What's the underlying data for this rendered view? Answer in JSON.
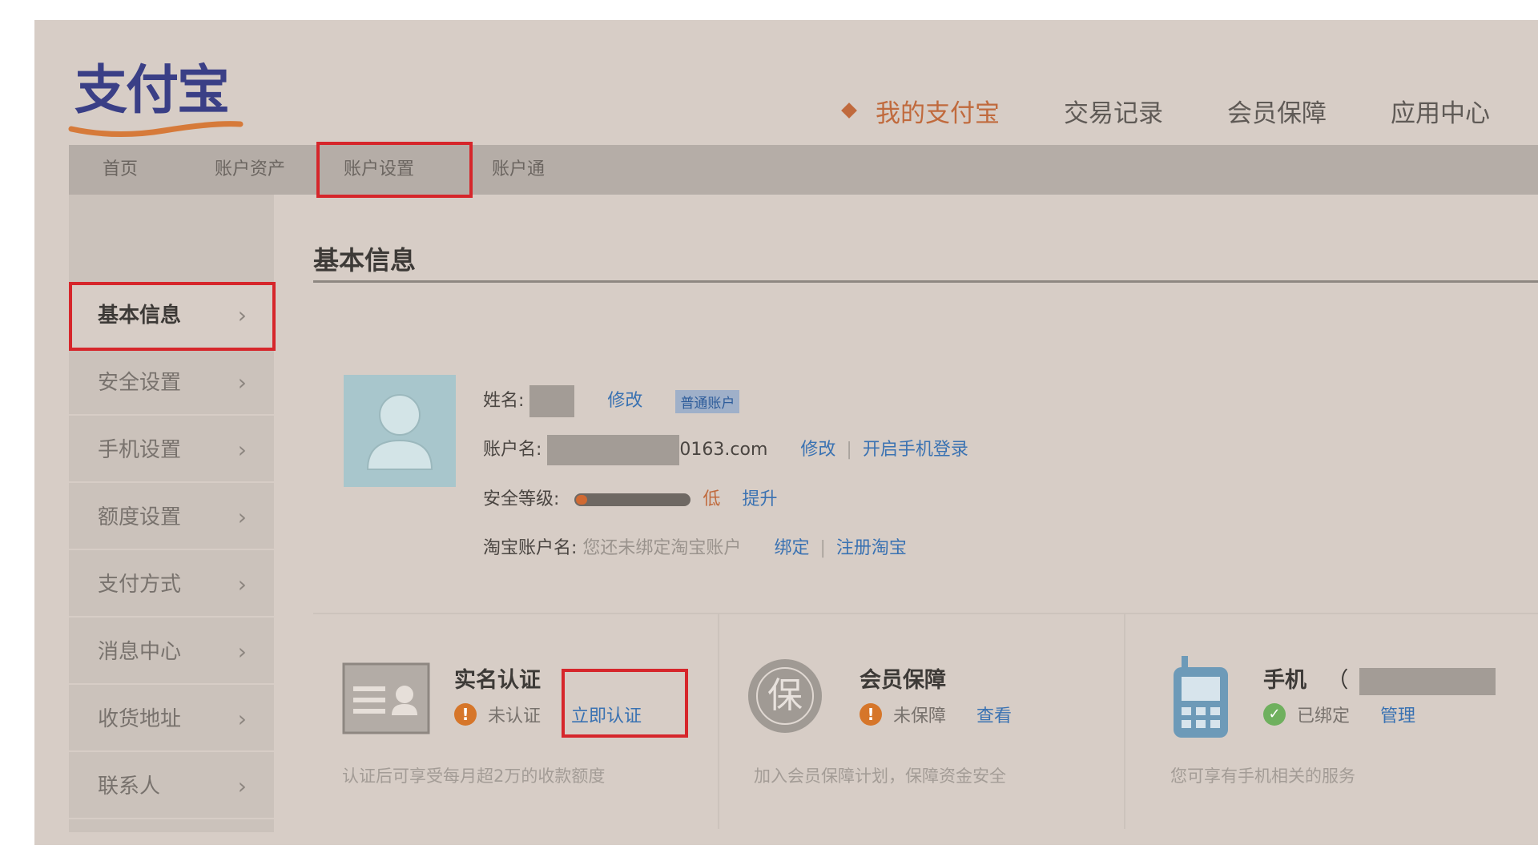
{
  "brand": {
    "logo_text": "支付宝"
  },
  "topnav": [
    {
      "label": "我的支付宝",
      "active": true
    },
    {
      "label": "交易记录"
    },
    {
      "label": "会员保障"
    },
    {
      "label": "应用中心"
    }
  ],
  "subnav": [
    {
      "label": "首页"
    },
    {
      "label": "账户资产"
    },
    {
      "label": "账户设置",
      "active": true
    },
    {
      "label": "账户通"
    }
  ],
  "sidebar": [
    {
      "label": "基本信息",
      "active": true
    },
    {
      "label": "安全设置"
    },
    {
      "label": "手机设置"
    },
    {
      "label": "额度设置"
    },
    {
      "label": "支付方式"
    },
    {
      "label": "消息中心"
    },
    {
      "label": "收货地址"
    },
    {
      "label": "联系人"
    }
  ],
  "sidebar_chevron": "›",
  "main": {
    "title": "基本信息",
    "profile": {
      "name_label": "姓名:",
      "name_edit": "修改",
      "account_type": "普通账户",
      "account_label": "账户名:",
      "account_suffix": "0163.com",
      "account_edit": "修改",
      "phone_login": "开启手机登录",
      "security_label": "安全等级:",
      "security_level_text": "低",
      "security_level_fraction": 0.1,
      "security_upgrade": "提升",
      "taobao_label": "淘宝账户名:",
      "taobao_hint": "您还未绑定淘宝账户",
      "taobao_bind": "绑定",
      "taobao_register": "注册淘宝"
    },
    "cards": [
      {
        "title": "实名认证",
        "status": "未认证",
        "action": "立即认证",
        "desc": "认证后可享受每月超2万的收款额度"
      },
      {
        "title": "会员保障",
        "icon_char": "保",
        "status": "未保障",
        "action": "查看",
        "desc": "加入会员保障计划，保障资金安全"
      },
      {
        "title": "手机",
        "title_paren": "（",
        "status": "已绑定",
        "action": "管理",
        "desc": "您可享有手机相关的服务"
      }
    ]
  },
  "colors": {
    "accent_orange": "#c06a3d",
    "link_blue": "#3a72b2",
    "highlight_red": "#d6262b",
    "brand_blue": "#3a3f86"
  }
}
